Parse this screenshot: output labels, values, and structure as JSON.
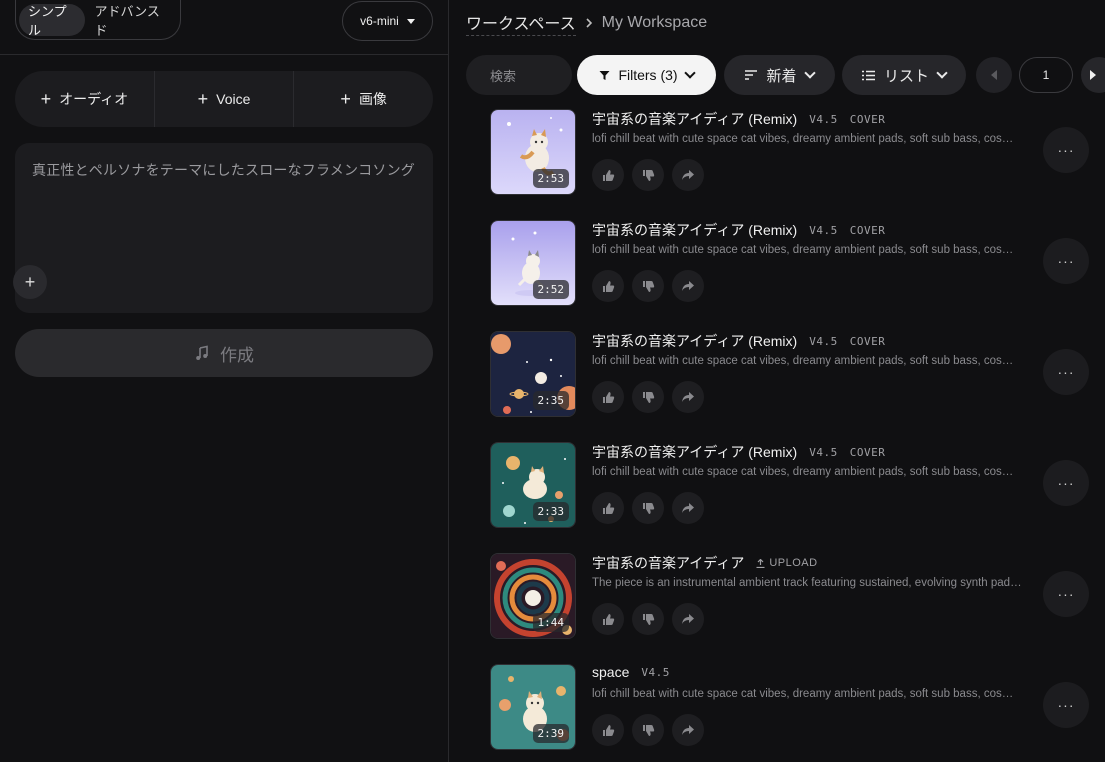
{
  "left_panel": {
    "mode_simple": "シンプル",
    "mode_advanced": "アドバンスド",
    "model": "v6-mini",
    "add_audio": "オーディオ",
    "add_voice": "Voice",
    "add_image": "画像",
    "prompt_placeholder": "真正性とペルソナをテーマにしたスローなフラメンコソング",
    "create_label": "作成"
  },
  "header": {
    "breadcrumb_parent": "ワークスペース",
    "breadcrumb_current": "My Workspace"
  },
  "toolbar": {
    "search_placeholder": "検索",
    "filters_label": "Filters (3)",
    "sort_label": "新着",
    "view_label": "リスト",
    "page_number": "1"
  },
  "songs": [
    {
      "title": "宇宙系の音楽アイディア (Remix)",
      "version": "V4.5",
      "tag": "COVER",
      "description": "lofi chill beat with cute space cat vibes, dreamy ambient pads, soft sub bass, cosmic...",
      "duration": "2:53"
    },
    {
      "title": "宇宙系の音楽アイディア (Remix)",
      "version": "V4.5",
      "tag": "COVER",
      "description": "lofi chill beat with cute space cat vibes, dreamy ambient pads, soft sub bass, cosmic...",
      "duration": "2:52"
    },
    {
      "title": "宇宙系の音楽アイディア (Remix)",
      "version": "V4.5",
      "tag": "COVER",
      "description": "lofi chill beat with cute space cat vibes, dreamy ambient pads, soft sub bass, cosmic...",
      "duration": "2:35"
    },
    {
      "title": "宇宙系の音楽アイディア (Remix)",
      "version": "V4.5",
      "tag": "COVER",
      "description": "lofi chill beat with cute space cat vibes, dreamy ambient pads, soft sub bass, cosmic...",
      "duration": "2:33"
    },
    {
      "title": "宇宙系の音楽アイディア",
      "version": "",
      "tag": "UPLOAD",
      "description": "The piece is an instrumental ambient track featuring sustained, evolving synth pads,...",
      "duration": "1:44"
    },
    {
      "title": "space",
      "version": "V4.5",
      "tag": "",
      "description": "lofi chill beat with cute space cat vibes, dreamy ambient pads, soft sub bass, cosmic...",
      "duration": "2:39"
    }
  ]
}
